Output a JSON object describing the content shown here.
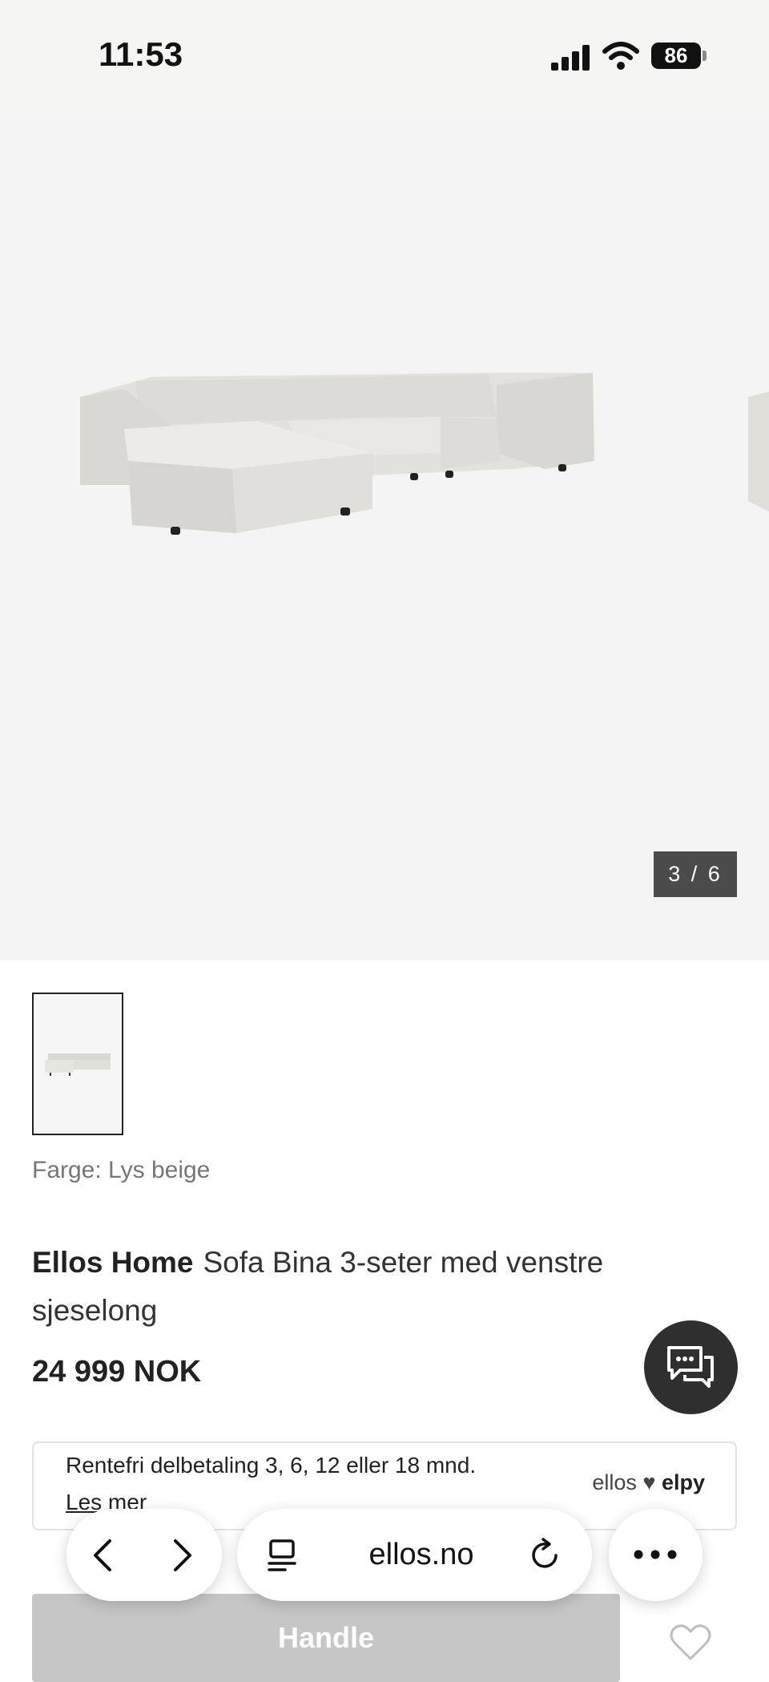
{
  "status_bar": {
    "time": "11:53",
    "battery": "86"
  },
  "gallery": {
    "counter": "3 / 6"
  },
  "product": {
    "color_label": "Farge: Lys beige",
    "brand": "Ellos Home",
    "title": "Sofa Bina 3-seter med venstre sjeselong",
    "price": "24 999 NOK"
  },
  "payment": {
    "text": "Rentefri delbetaling 3, 6, 12 eller 18 mnd.",
    "link": "Les mer",
    "logo_left": "ellos",
    "logo_right": "elpy"
  },
  "cta": {
    "label": "Handle"
  },
  "browser": {
    "url": "ellos.no"
  },
  "icons": [
    "signal-icon",
    "wifi-icon",
    "chat-icon",
    "heart-icon",
    "back-icon",
    "forward-icon",
    "reader-icon",
    "reload-icon",
    "more-icon"
  ]
}
